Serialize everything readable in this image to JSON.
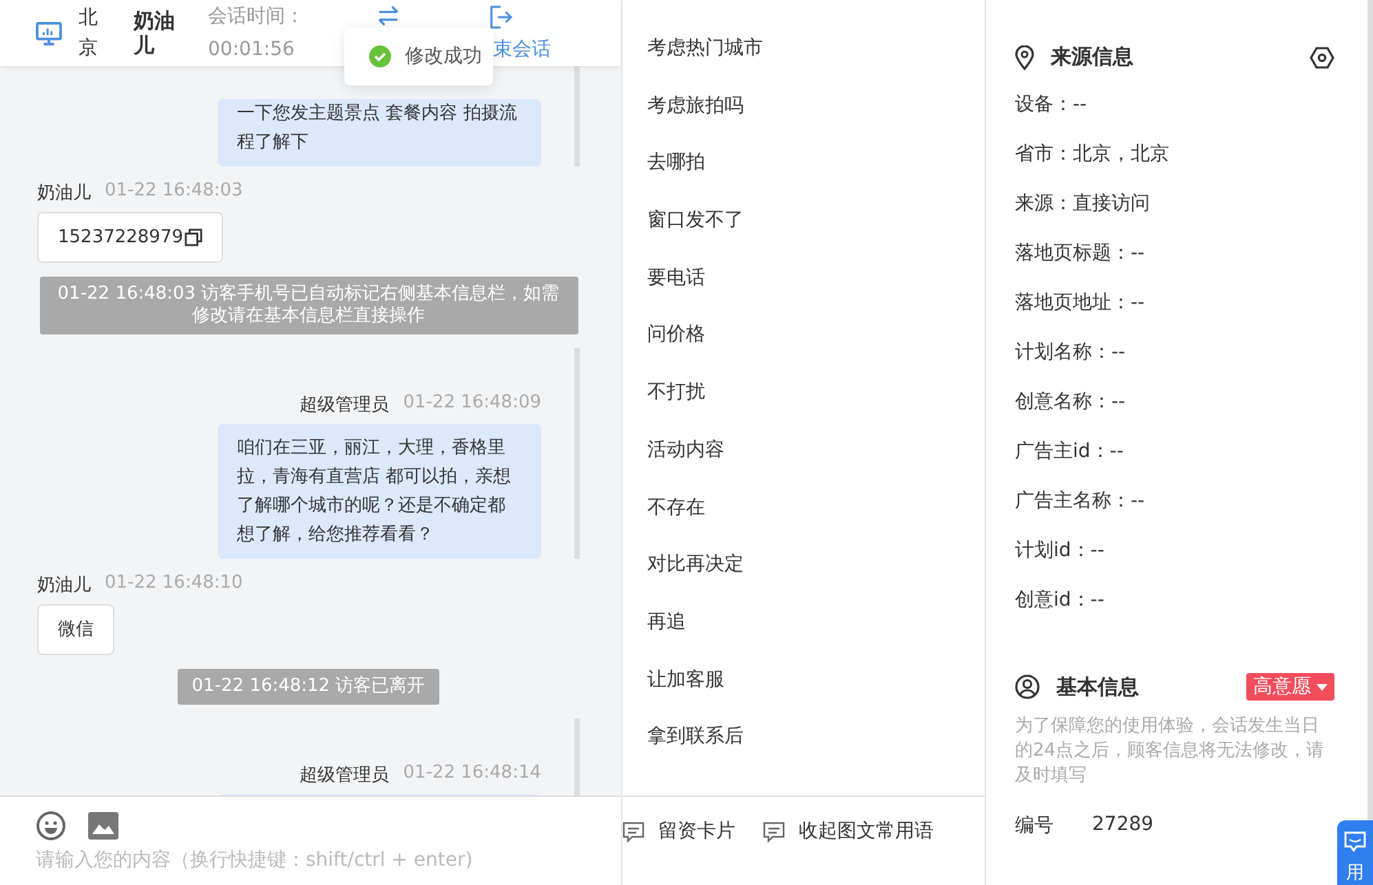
{
  "header": {
    "location": "北京",
    "visitor_name": "奶油儿",
    "session_label": "会话时间：",
    "session_time": "00:01:56",
    "end_label": "束会话"
  },
  "toast": {
    "text": "修改成功"
  },
  "messages": [
    {
      "kind": "agent",
      "text": "一下您发主题景点 套餐内容 拍摄流程了解下"
    },
    {
      "kind": "visitor",
      "name": "奶油儿",
      "time": "01-22 16:48:03",
      "text": "15237228979",
      "copyable": true
    },
    {
      "kind": "system",
      "text": "01-22 16:48:03 访客手机号已自动标记右侧基本信息栏，如需修改请在基本信息栏直接操作"
    },
    {
      "kind": "agent",
      "name": "超级管理员",
      "time": "01-22 16:48:09",
      "text": "咱们在三亚，丽江，大理，香格里拉，青海有直营店 都可以拍，亲想了解哪个城市的呢？还是不确定都想了解，给您推荐看看？"
    },
    {
      "kind": "visitor",
      "name": "奶油儿",
      "time": "01-22 16:48:10",
      "text": "微信",
      "copyable": false
    },
    {
      "kind": "system",
      "text": "01-22 16:48:12 访客已离开"
    },
    {
      "kind": "agent",
      "name": "超级管理员",
      "time": "01-22 16:48:14"
    }
  ],
  "composer": {
    "placeholder": "请输入您的内容（换行快捷键：shift/ctrl + enter)"
  },
  "quick_replies": [
    "考虑热门城市",
    "考虑旅拍吗",
    "去哪拍",
    "窗口发不了",
    "要电话",
    "问价格",
    "不打扰",
    "活动内容",
    "不存在",
    "对比再决定",
    "再追",
    "让加客服",
    "拿到联系后"
  ],
  "quick_actions": [
    "留资卡片",
    "收起图文常用语"
  ],
  "source_info": {
    "title": "来源信息",
    "fields": [
      "设备：--",
      "省市：北京，北京",
      "来源：直接访问",
      "落地页标题：--",
      "落地页地址：--",
      "计划名称：--",
      "创意名称：--",
      "广告主id：--",
      "广告主名称：--",
      "计划id：--",
      "创意id：--"
    ]
  },
  "basic_info": {
    "title": "基本信息",
    "tag": "高意愿",
    "note": "为了保障您的使用体验，会话发生当日的24点之后，顾客信息将无法修改，请及时填写",
    "fields": [
      {
        "label": "编号",
        "value": "27289"
      }
    ]
  },
  "float_button": {
    "label": "用"
  }
}
